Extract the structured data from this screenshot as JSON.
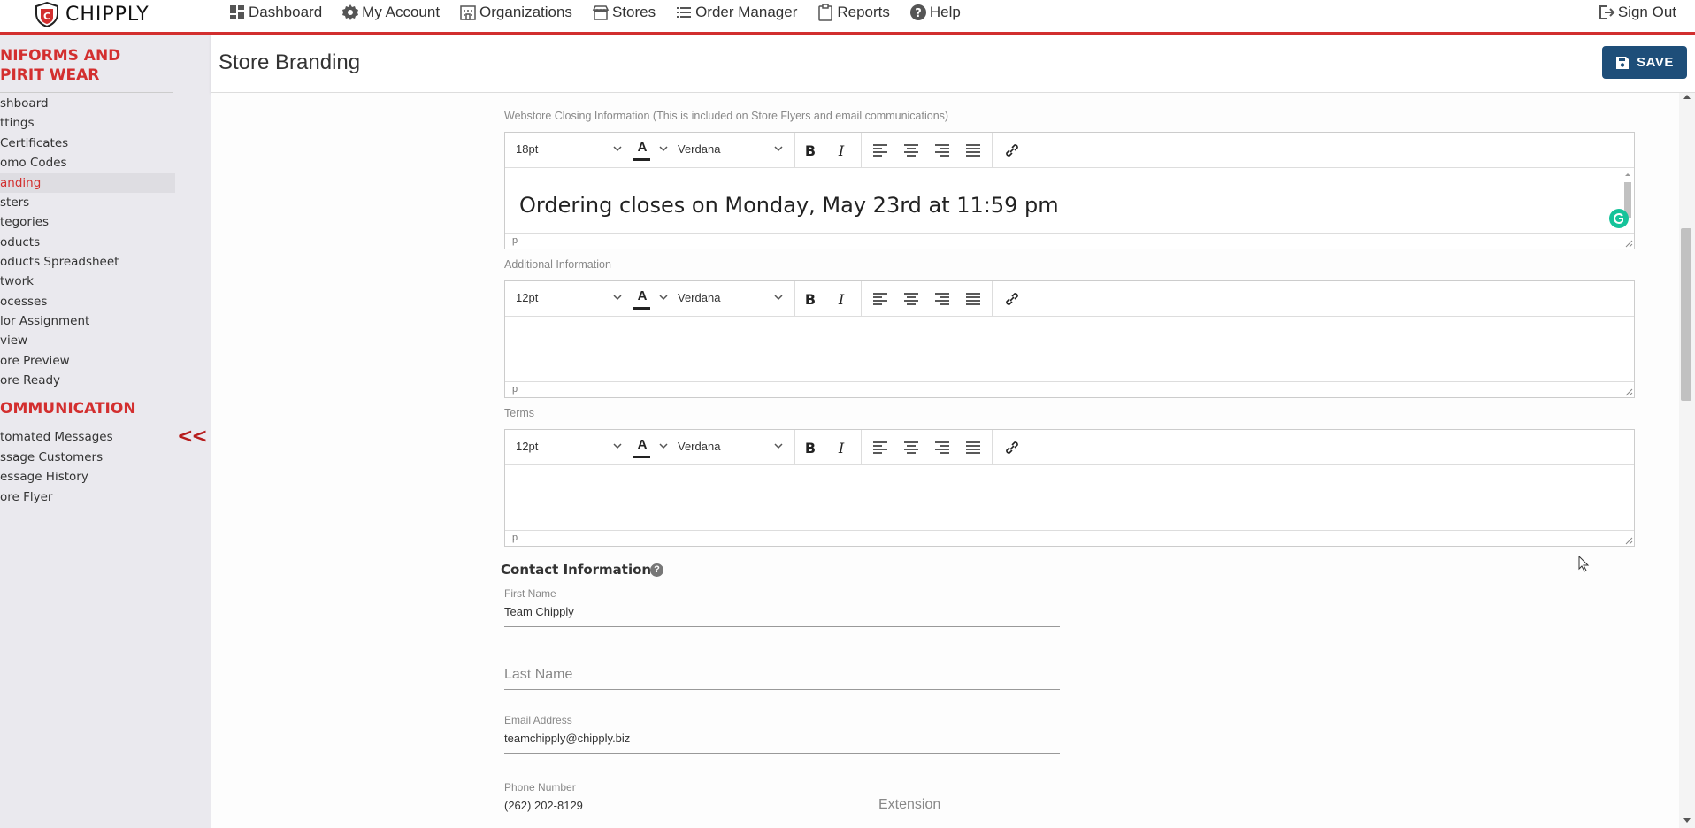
{
  "nav": {
    "logo_text": "CHIPPLY",
    "items": [
      {
        "label": "Dashboard",
        "icon": "dashboard-icon"
      },
      {
        "label": "My Account",
        "icon": "gear-icon"
      },
      {
        "label": "Organizations",
        "icon": "building-icon"
      },
      {
        "label": "Stores",
        "icon": "store-icon"
      },
      {
        "label": "Order Manager",
        "icon": "list-icon"
      },
      {
        "label": "Reports",
        "icon": "clipboard-icon"
      },
      {
        "label": "Help",
        "icon": "help-icon"
      }
    ],
    "signout_label": "Sign Out"
  },
  "sidebar": {
    "store_heading_line1": "NIFORMS AND",
    "store_heading_line2": "PIRIT WEAR",
    "store_items": [
      "shboard",
      "ttings",
      "Certificates",
      "omo Codes",
      "anding",
      "sters",
      "tegories",
      "oducts",
      "oducts Spreadsheet",
      "twork",
      "ocesses",
      "lor Assignment",
      "view",
      "ore Preview",
      "ore Ready"
    ],
    "active_item_index": 4,
    "comm_heading": "OMMUNICATION",
    "comm_items": [
      "tomated Messages",
      "ssage Customers",
      "essage History",
      "ore Flyer"
    ],
    "collapse_label": "<<"
  },
  "header": {
    "title": "Store Branding",
    "save_label": "SAVE"
  },
  "editors": [
    {
      "label": "Webstore Closing Information (This is included on Store Flyers and email communications)",
      "font_size": "18pt",
      "font_family": "Verdana",
      "content": "Ordering closes on Monday, May 23rd at 11:59 pm",
      "footer": "p"
    },
    {
      "label": "Additional Information",
      "font_size": "12pt",
      "font_family": "Verdana",
      "content": "",
      "footer": "p"
    },
    {
      "label": "Terms",
      "font_size": "12pt",
      "font_family": "Verdana",
      "content": "",
      "footer": "p"
    }
  ],
  "contact": {
    "title": "Contact Information",
    "help": "?",
    "first_name_label": "First Name",
    "first_name_value": "Team Chipply",
    "last_name_placeholder": "Last Name",
    "email_label": "Email Address",
    "email_value": "teamchipply@chipply.biz",
    "phone_label": "Phone Number",
    "phone_value": "(262) 202-8129",
    "extension_placeholder": "Extension"
  },
  "colors": {
    "brand_red": "#d32f2f",
    "save_blue": "#1e4e79",
    "sidebar_bg": "#eae9ee",
    "grammarly_green": "#15c39a"
  }
}
